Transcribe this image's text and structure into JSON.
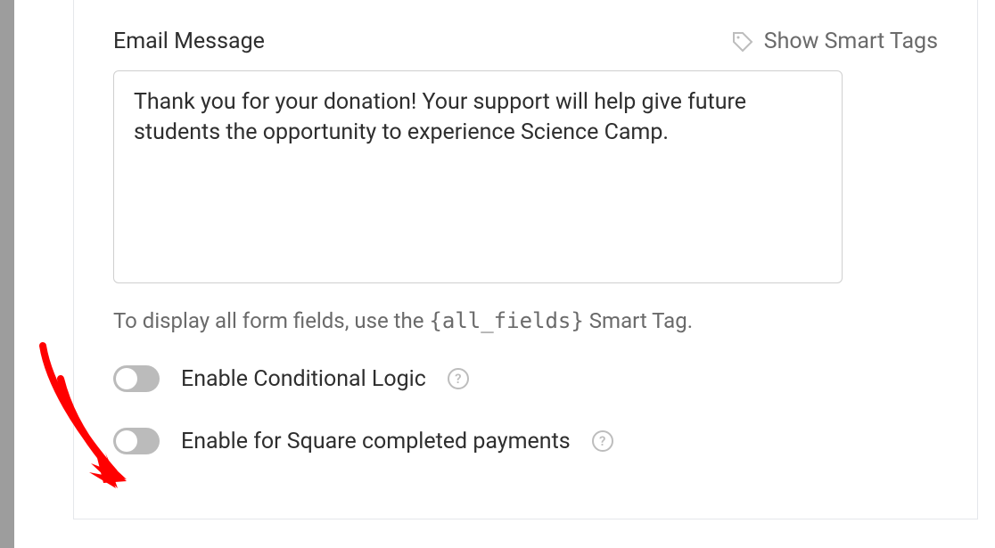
{
  "section": {
    "label": "Email Message",
    "smart_tags_link": "Show Smart Tags",
    "textarea_value": "Thank you for your donation! Your support will help give future students the opportunity to experience Science Camp.",
    "help_text_prefix": "To display all form fields, use the ",
    "help_text_code": "{all_fields}",
    "help_text_suffix": " Smart Tag."
  },
  "toggles": {
    "conditional_logic": {
      "label": "Enable Conditional Logic",
      "state": "off"
    },
    "square_payments": {
      "label": "Enable for Square completed payments",
      "state": "off"
    }
  },
  "annotation": {
    "arrow_color": "#ff0000"
  }
}
